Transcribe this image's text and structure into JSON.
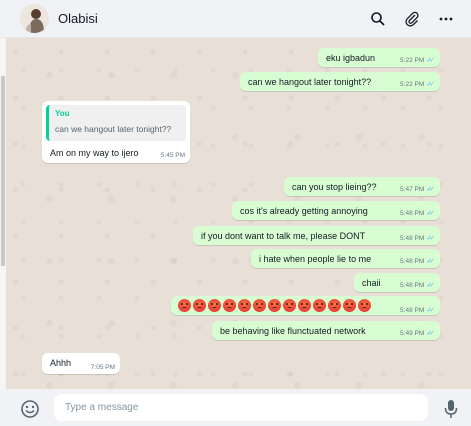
{
  "header": {
    "contact_name": "Olabisi",
    "icons": [
      "search-icon",
      "attach-icon",
      "menu-icon"
    ]
  },
  "messages": [
    {
      "type": "out",
      "text": "eku igbadun",
      "time": "5:22 PM"
    },
    {
      "type": "out",
      "text": "can we hangout later tonight??",
      "time": "5:22 PM"
    },
    {
      "type": "in",
      "quote_author": "You",
      "quote_text": "can we hangout later tonight??",
      "text": "Am on my way to ijero",
      "time": "5:45 PM"
    },
    {
      "type": "out",
      "text": "can you stop lieing??",
      "time": "5:47 PM"
    },
    {
      "type": "out",
      "text": "cos it's already getting annoying",
      "time": "5:48 PM"
    },
    {
      "type": "out",
      "text": "if you dont want to talk me, please DONT",
      "time": "5:48 PM"
    },
    {
      "type": "out",
      "text": "i hate when people lie to me",
      "time": "5:48 PM"
    },
    {
      "type": "out",
      "text": "chaii",
      "time": "5:48 PM"
    },
    {
      "type": "out",
      "emoji": "angry-face",
      "emoji_count": 13,
      "time": "5:48 PM"
    },
    {
      "type": "out",
      "text": "be behaving like flunctuated network",
      "time": "5:49 PM"
    },
    {
      "type": "in",
      "text": "Ahhh",
      "time": "7:05 PM"
    }
  ],
  "composer": {
    "placeholder": "Type a message",
    "icons": [
      "emoji-icon",
      "mic-icon"
    ]
  },
  "colors": {
    "outgoing_bubble": "#d9fdd3",
    "incoming_bubble": "#ffffff",
    "chat_background": "#e8e0d6",
    "read_ticks": "#53bdeb",
    "quote_accent": "#06cf9c"
  }
}
